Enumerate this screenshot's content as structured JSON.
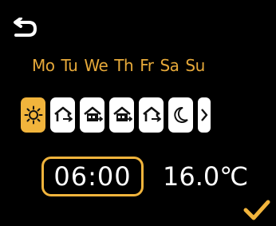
{
  "days": [
    "Mo",
    "Tu",
    "We",
    "Th",
    "Fr",
    "Sa",
    "Su"
  ],
  "modes": [
    {
      "icon": "sun-icon",
      "active": true
    },
    {
      "icon": "home-arrive-icon",
      "active": false
    },
    {
      "icon": "home-eco-icon",
      "active": false
    },
    {
      "icon": "home-eco-icon",
      "active": false
    },
    {
      "icon": "home-arrive-icon",
      "active": false
    },
    {
      "icon": "moon-icon",
      "active": false
    }
  ],
  "schedule": {
    "time": "06:00",
    "temperature": "16.0℃"
  },
  "colors": {
    "accent": "#f1b43c",
    "day_text": "#e6a93a",
    "background": "#000000"
  },
  "icons": {
    "back": "back-arrow-icon",
    "next": "chevron-right-icon",
    "confirm": "checkmark-icon"
  }
}
